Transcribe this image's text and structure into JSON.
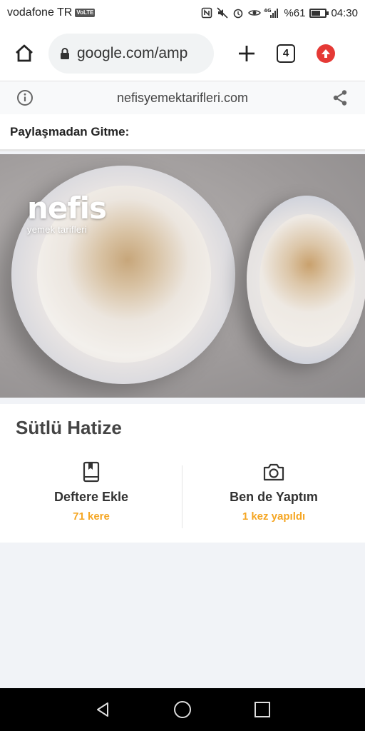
{
  "status_bar": {
    "carrier": "vodafone TR",
    "volte": "VoLTE",
    "network": "4G",
    "battery": "%61",
    "time": "04:30"
  },
  "browser": {
    "url": "google.com/amp",
    "tab_count": "4"
  },
  "amp_header": {
    "domain": "nefisyemektarifleri.com"
  },
  "share_prompt": "Paylaşmadan Gitme:",
  "photo": {
    "logo_main": "nefis",
    "logo_sub": "yemek tarifleri"
  },
  "recipe": {
    "title": "Sütlü Hatize",
    "actions": [
      {
        "label": "Deftere Ekle",
        "count": "71 kere",
        "icon": "notebook-icon"
      },
      {
        "label": "Ben de Yaptım",
        "count": "1 kez yapıldı",
        "icon": "camera-icon"
      }
    ]
  },
  "colors": {
    "accent_count": "#f5a623",
    "upgrade_red": "#e53935",
    "page_bg": "#f1f3f7"
  }
}
